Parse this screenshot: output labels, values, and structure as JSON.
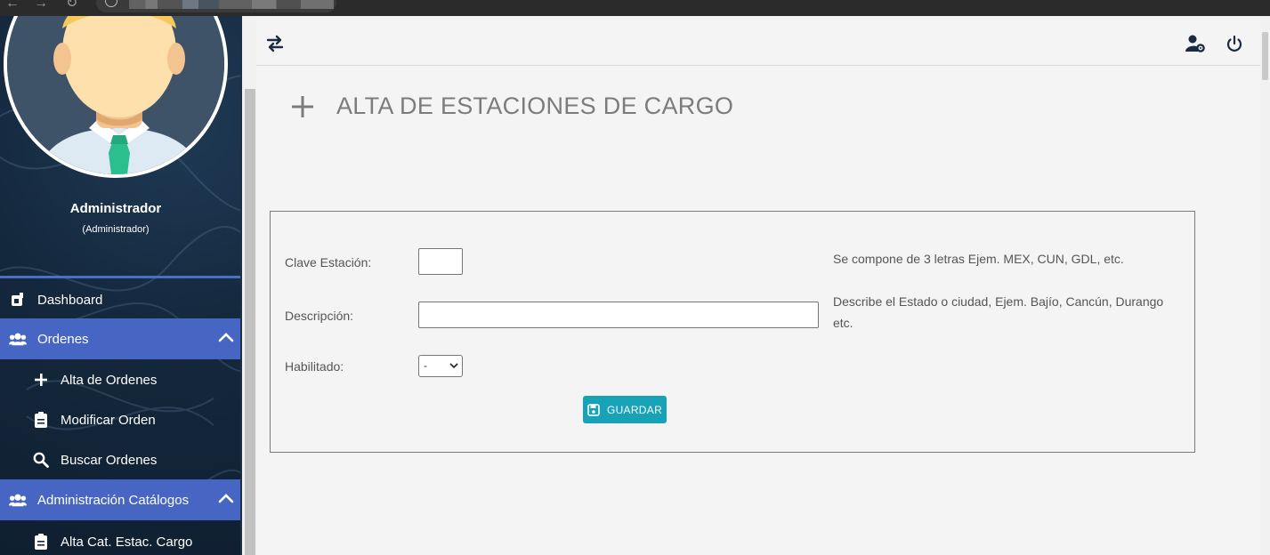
{
  "sidebar": {
    "user": {
      "name": "Administrador",
      "role": "(Administrador)"
    },
    "items": [
      {
        "label": "Dashboard"
      },
      {
        "label": "Ordenes"
      },
      {
        "label": "Alta de Ordenes"
      },
      {
        "label": "Modificar Orden"
      },
      {
        "label": "Buscar Ordenes"
      },
      {
        "label": "Administración Catálogos"
      },
      {
        "label": "Alta Cat. Estac. Cargo"
      }
    ]
  },
  "page": {
    "title": "ALTA DE ESTACIONES DE CARGO"
  },
  "form": {
    "clave": {
      "label": "Clave Estación:",
      "value": "",
      "hint": "Se compone de 3 letras Ejem. MEX, CUN, GDL, etc."
    },
    "descripcion": {
      "label": "Descripción:",
      "value": "",
      "hint": "Describe el Estado o ciudad, Ejem. Bajío, Cancún, Durango etc."
    },
    "habilitado": {
      "label": "Habilitado:",
      "selected": "-"
    },
    "save_label": "GUARDAR"
  },
  "colors": {
    "sidebar_bg": "#14283d",
    "section_active": "#4766c4",
    "save_button": "#17a2b8",
    "page_bg": "#f4f4f4"
  }
}
